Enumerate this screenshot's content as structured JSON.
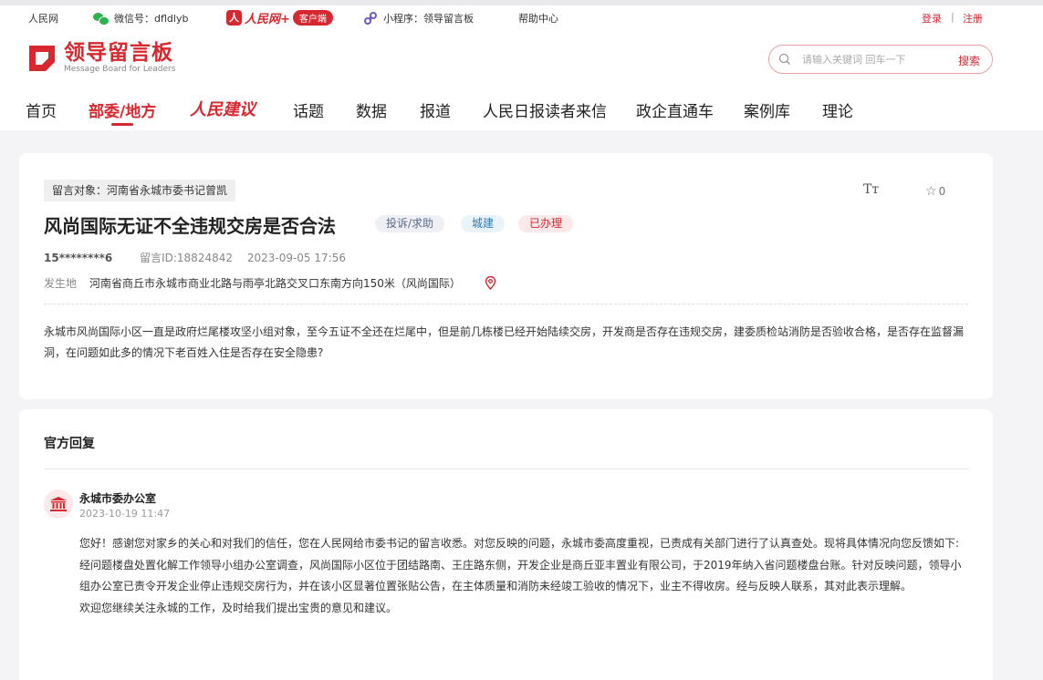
{
  "topbar": {
    "site": "人民网",
    "wechat": "微信号：dfldlyb",
    "app_logo_text": "人民网+",
    "app_badge": "客户端",
    "miniprogram": "小程序：领导留言板",
    "help": "帮助中心",
    "login": "登录",
    "separator": "|",
    "register": "注册"
  },
  "logo": {
    "cn": "领导留言板",
    "en": "Message Board for Leaders"
  },
  "search": {
    "placeholder": "请输入关键词 回车一下",
    "button": "搜索"
  },
  "nav": {
    "items": [
      "首页",
      "部委/地方",
      "人民建议",
      "话题",
      "数据",
      "报道",
      "人民日报读者来信",
      "政企直通车",
      "案例库",
      "理论"
    ],
    "active": "部委/地方"
  },
  "message": {
    "target": "留言对象：河南省永城市委书记曾凯",
    "font_icon_text": "Tт",
    "favorite_count": "0",
    "title": "风尚国际无证不全违规交房是否合法",
    "tags": [
      "投诉/求助",
      "城建",
      "已办理"
    ],
    "user": "15********6",
    "message_id": "留言ID:18824842",
    "datetime": "2023-09-05 17:56",
    "location_label": "发生地",
    "location": "河南省商丘市永城市商业北路与雨亭北路交叉口东南方向150米（风尚国际）",
    "content": "永城市风尚国际小区一直是政府烂尾楼攻坚小组对象，至今五证不全还在烂尾中，但是前几栋楼已经开始陆续交房，开发商是否存在违规交房，建委质检站消防是否验收合格，是否存在监督漏洞，在问题如此多的情况下老百姓入住是否存在安全隐患?"
  },
  "reply": {
    "heading": "官方回复",
    "org": "永城市委办公室",
    "datetime": "2023-10-19 11:47",
    "paragraphs": [
      "您好！感谢您对家乡的关心和对我们的信任，您在人民网给市委书记的留言收悉。对您反映的问题，永城市委高度重视，已责成有关部门进行了认真查处。现将具体情况向您反馈如下:",
      "经问题楼盘处置化解工作领导小组办公室调查，风尚国际小区位于团结路南、王庄路东侧，开发企业是商丘亚丰置业有限公司，于2019年纳入省问题楼盘台账。针对反映问题，领导小组办公室已责令开发企业停止违规交房行为，并在该小区显著位置张贴公告，在主体质量和消防未经竣工验收的情况下，业主不得收房。经与反映人联系，其对此表示理解。",
      "欢迎您继续关注永城的工作，及时给我们提出宝贵的意见和建议。"
    ]
  },
  "colors": {
    "brand_red": "#d7282f",
    "page_bg": "#f4f4f6"
  }
}
